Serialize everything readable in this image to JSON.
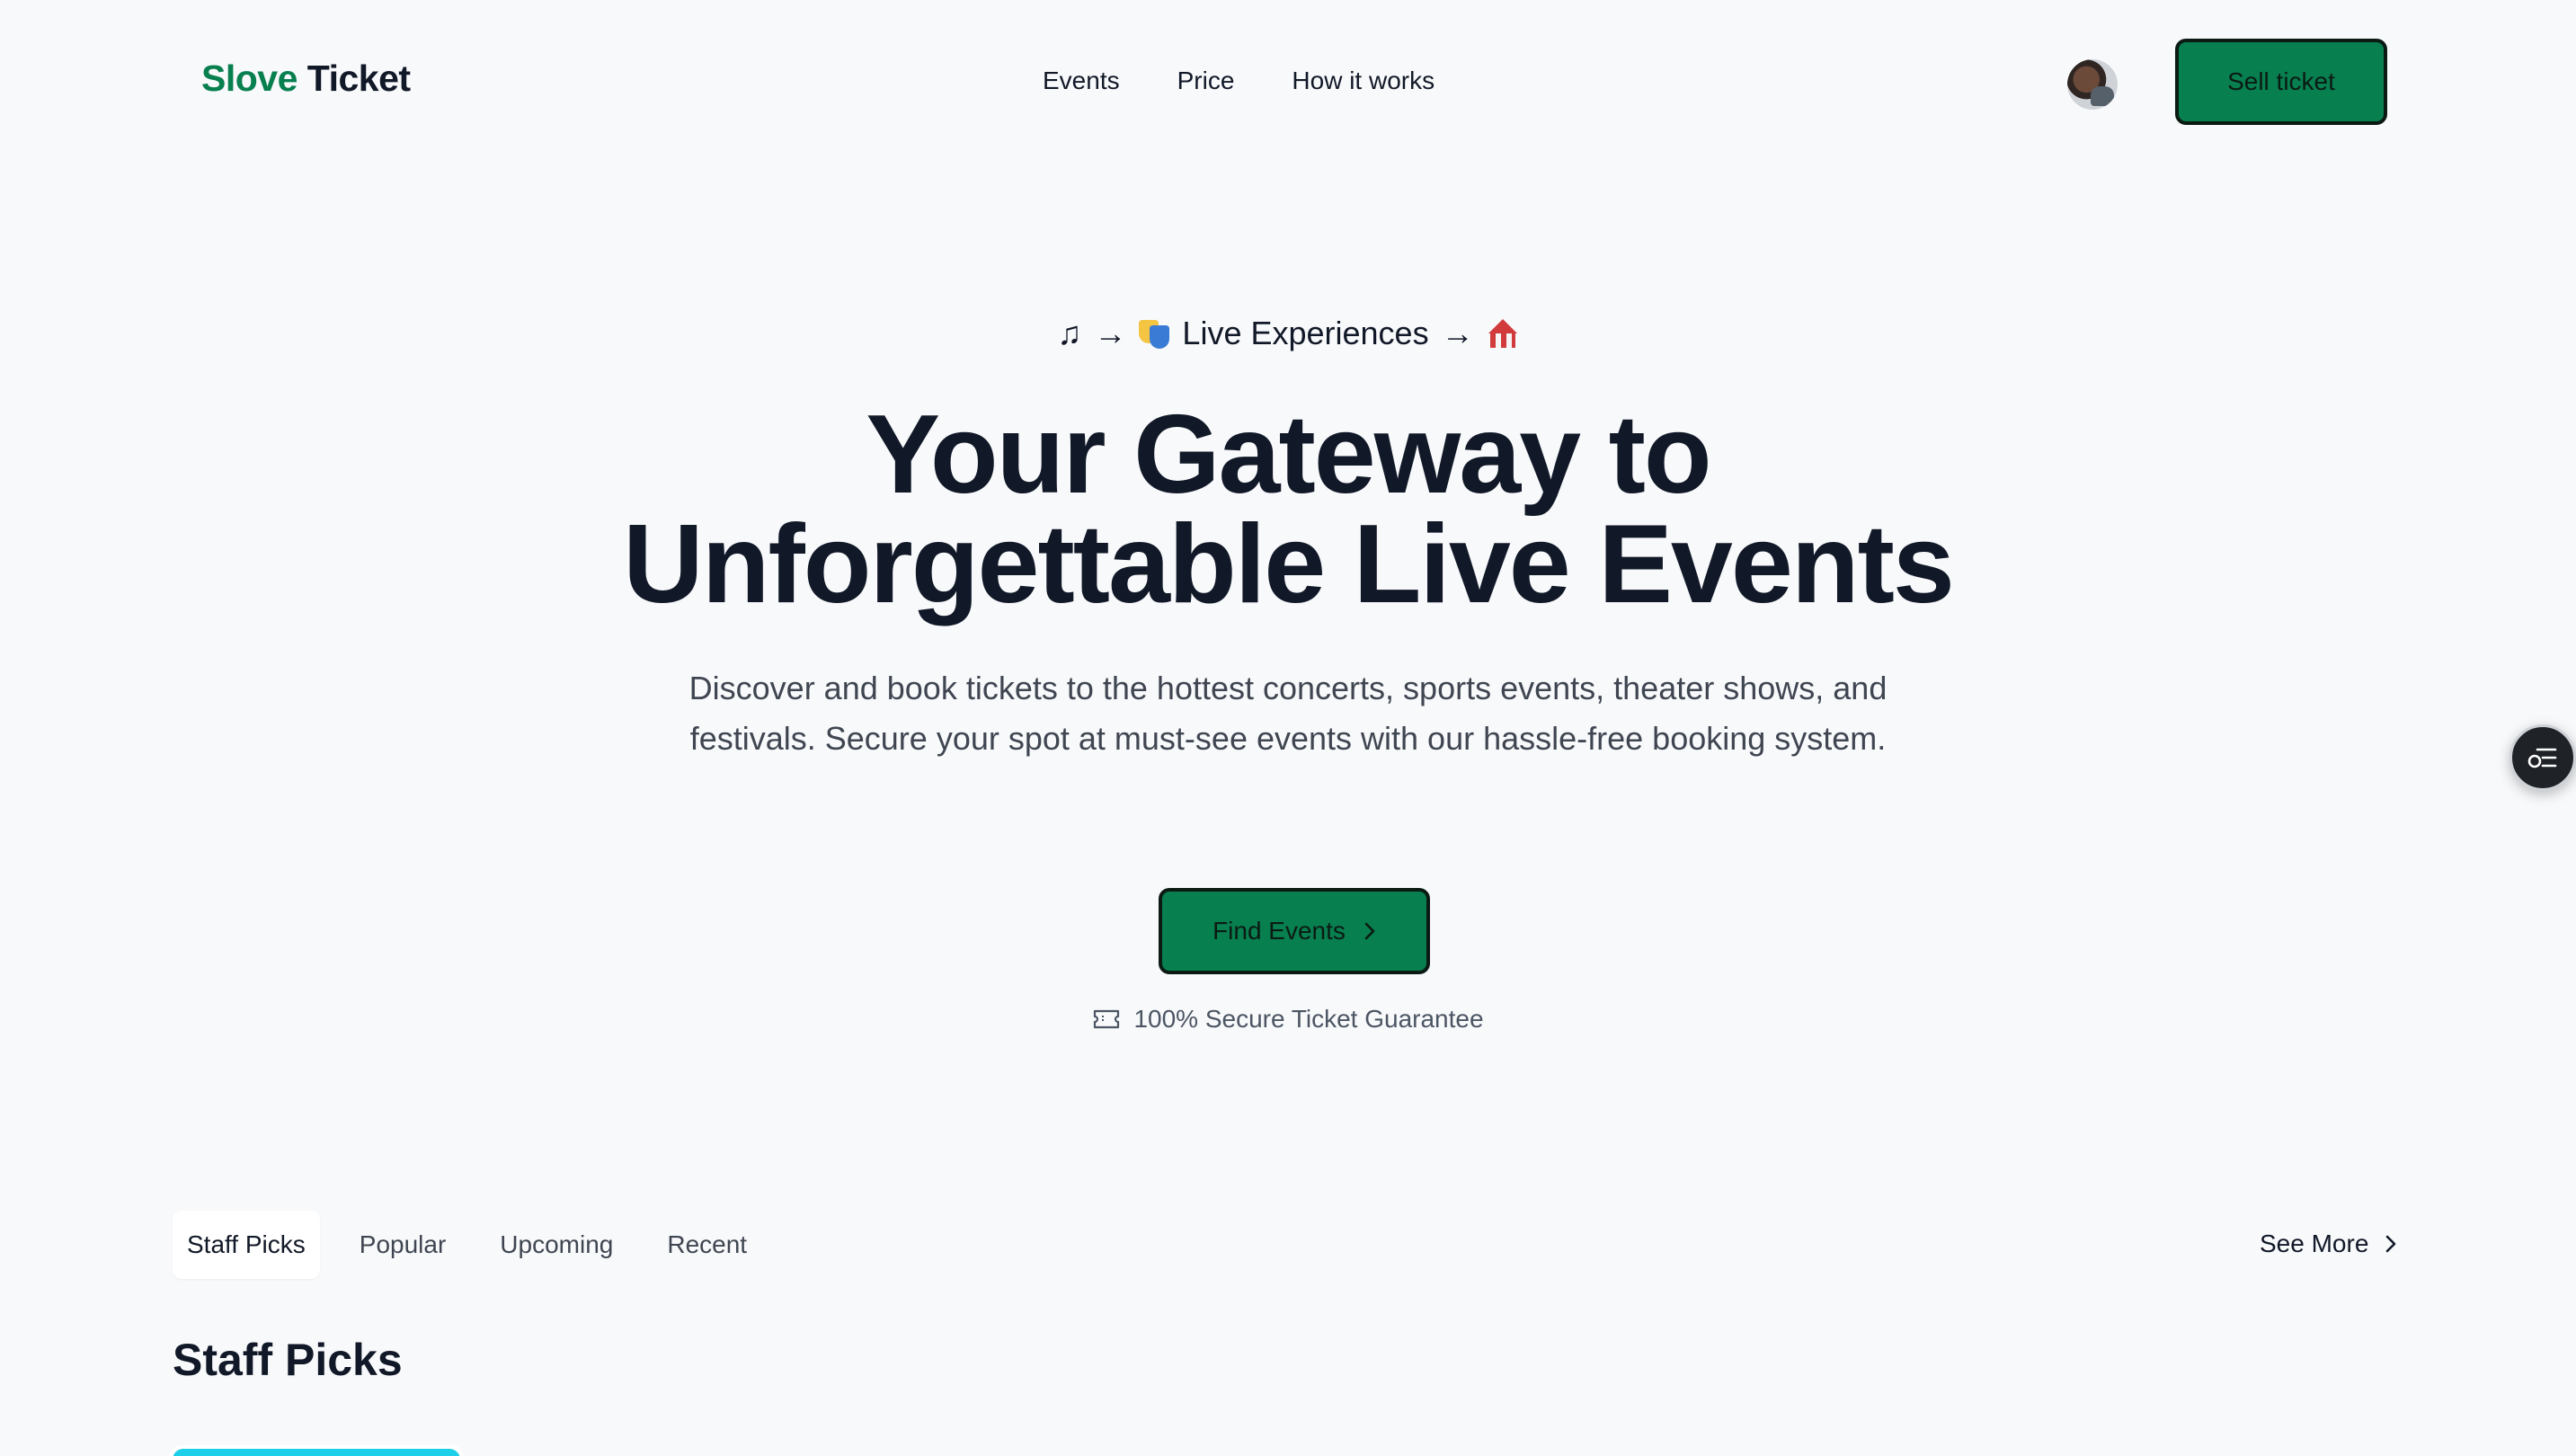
{
  "header": {
    "logo_brand": "Slove",
    "logo_rest": "Ticket",
    "nav": [
      {
        "label": "Events"
      },
      {
        "label": "Price"
      },
      {
        "label": "How it works"
      }
    ],
    "sell_label": "Sell ticket"
  },
  "hero": {
    "eyebrow_text": "Live Experiences",
    "eyebrow_icons": [
      "music-note-icon",
      "arrow-right-icon",
      "theater-masks-icon",
      "arrow-right-icon",
      "circus-tent-icon"
    ],
    "headline_line1": "Your Gateway to",
    "headline_line2": "Unforgettable Live Events",
    "subtext": "Discover and book tickets to the hottest concerts, sports events, theater shows, and festivals. Secure your spot at must-see events with our hassle-free booking system.",
    "cta_label": "Find Events",
    "guarantee_text": "100% Secure Ticket Guarantee"
  },
  "tabs": [
    {
      "label": "Staff Picks",
      "active": true
    },
    {
      "label": "Popular",
      "active": false
    },
    {
      "label": "Upcoming",
      "active": false
    },
    {
      "label": "Recent",
      "active": false
    }
  ],
  "see_more_label": "See More",
  "section_title": "Staff Picks",
  "colors": {
    "brand_green": "#087f4f",
    "background": "#f8f9fb",
    "text_dark": "#111827",
    "card_accent": "#1dcfe8"
  }
}
